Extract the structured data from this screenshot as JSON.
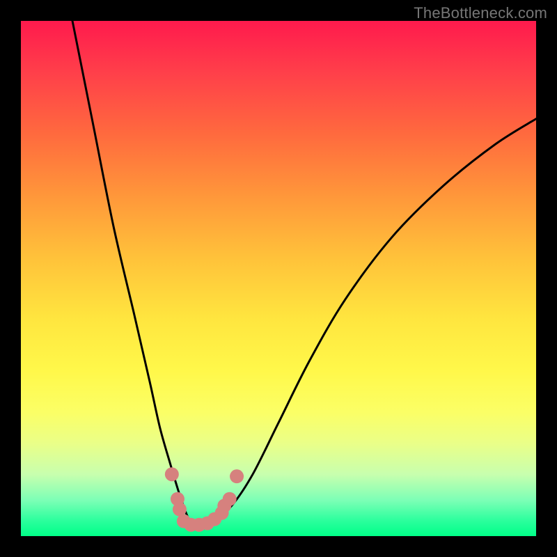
{
  "watermark": "TheBottleneck.com",
  "chart_data": {
    "type": "line",
    "title": "",
    "xlabel": "",
    "ylabel": "",
    "xlim": [
      0,
      100
    ],
    "ylim": [
      0,
      100
    ],
    "grid": false,
    "legend": false,
    "series": [
      {
        "name": "bottleneck-curve",
        "x": [
          10,
          14,
          18,
          22,
          25,
          27,
          29,
          30.5,
          31.5,
          32.5,
          33.5,
          35.5,
          38,
          41,
          45,
          50,
          56,
          63,
          72,
          82,
          92,
          100
        ],
        "y": [
          100,
          80,
          60,
          43,
          30,
          21,
          14,
          9,
          6,
          3.5,
          2.5,
          2.5,
          3.5,
          6,
          12,
          22,
          34,
          46,
          58,
          68,
          76,
          81
        ]
      }
    ],
    "annotations": [
      {
        "name": "valley-markers",
        "color": "#d6817e",
        "points": [
          {
            "x": 29.3,
            "y": 12
          },
          {
            "x": 30.4,
            "y": 7.2
          },
          {
            "x": 30.8,
            "y": 5.2
          },
          {
            "x": 31.6,
            "y": 2.9
          },
          {
            "x": 33.0,
            "y": 2.2
          },
          {
            "x": 34.6,
            "y": 2.2
          },
          {
            "x": 36.2,
            "y": 2.5
          },
          {
            "x": 37.6,
            "y": 3.3
          },
          {
            "x": 39.0,
            "y": 4.5
          },
          {
            "x": 39.5,
            "y": 5.9
          },
          {
            "x": 40.5,
            "y": 7.2
          },
          {
            "x": 41.9,
            "y": 11.6
          }
        ]
      }
    ]
  }
}
